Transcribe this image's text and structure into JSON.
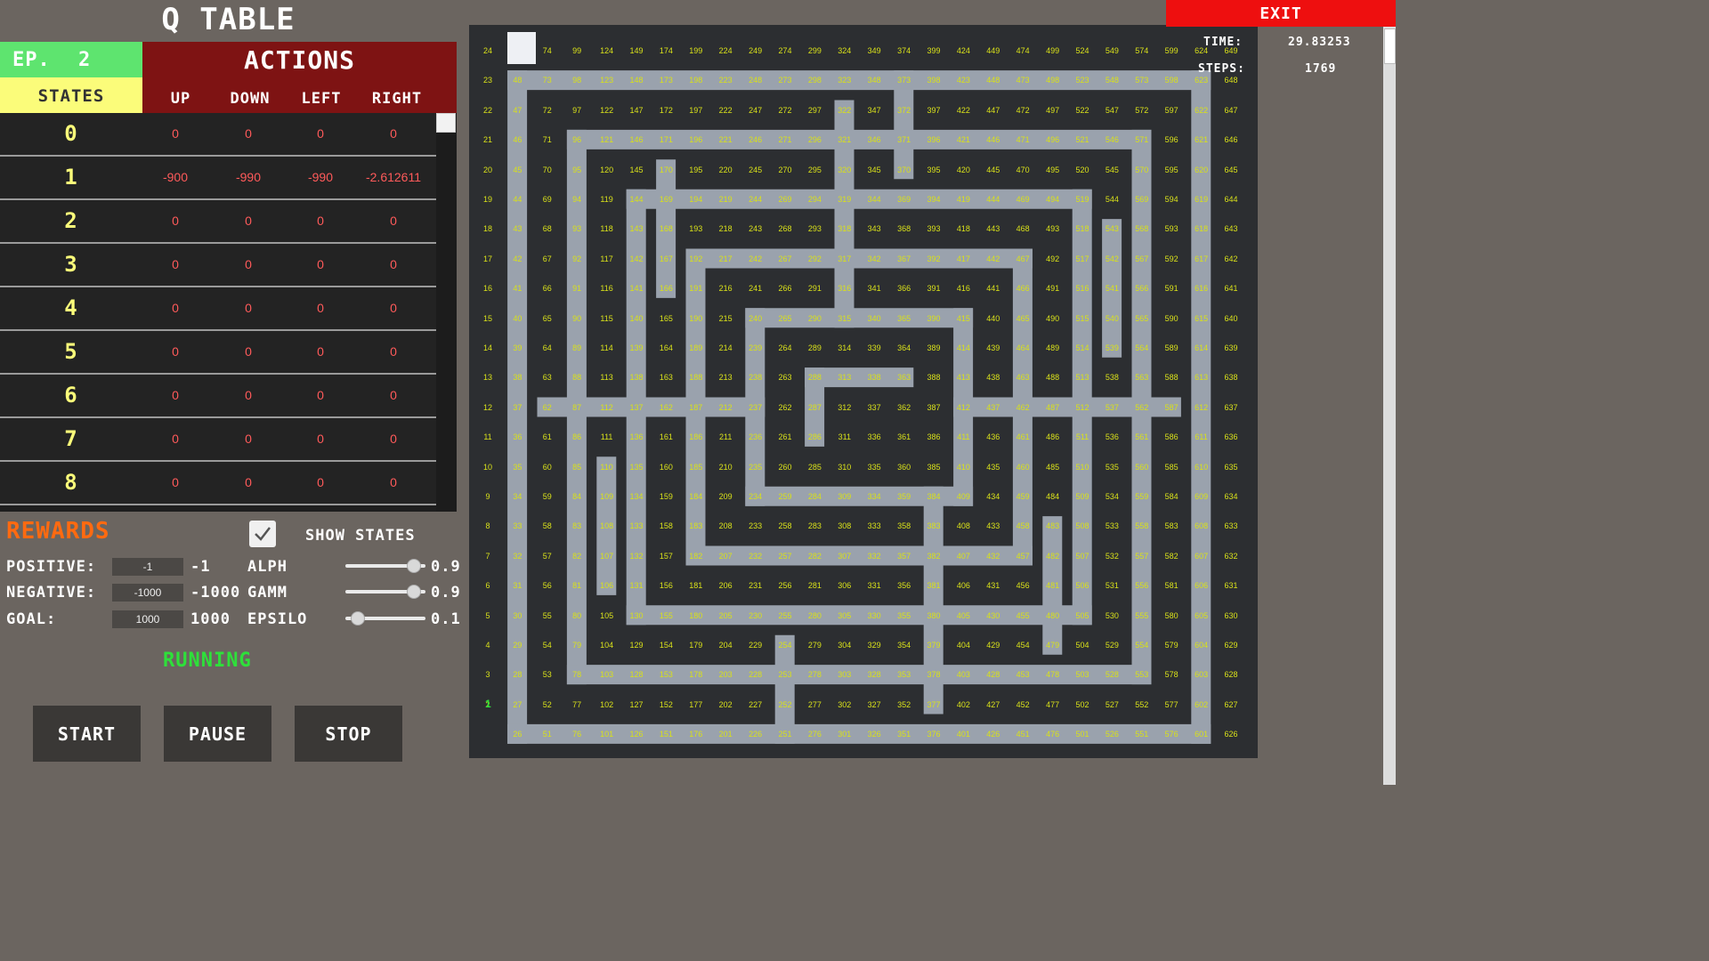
{
  "qtable": {
    "title": "Q TABLE",
    "episode_label": "EP.",
    "episode_value": "2",
    "states_header": "STATES",
    "actions_header": "ACTIONS",
    "columns": [
      "UP",
      "DOWN",
      "LEFT",
      "RIGHT"
    ],
    "rows": [
      {
        "state": "0",
        "values": [
          "0",
          "0",
          "0",
          "0"
        ]
      },
      {
        "state": "1",
        "values": [
          "-900",
          "-990",
          "-990",
          "-2.612611"
        ]
      },
      {
        "state": "2",
        "values": [
          "0",
          "0",
          "0",
          "0"
        ]
      },
      {
        "state": "3",
        "values": [
          "0",
          "0",
          "0",
          "0"
        ]
      },
      {
        "state": "4",
        "values": [
          "0",
          "0",
          "0",
          "0"
        ]
      },
      {
        "state": "5",
        "values": [
          "0",
          "0",
          "0",
          "0"
        ]
      },
      {
        "state": "6",
        "values": [
          "0",
          "0",
          "0",
          "0"
        ]
      },
      {
        "state": "7",
        "values": [
          "0",
          "0",
          "0",
          "0"
        ]
      },
      {
        "state": "8",
        "values": [
          "0",
          "0",
          "0",
          "0"
        ]
      }
    ]
  },
  "rewards": {
    "title": "REWARDS",
    "positive_label": "POSITIVE:",
    "positive_value": "-1",
    "positive_display": "-1",
    "negative_label": "NEGATIVE:",
    "negative_value": "-1000",
    "negative_display": "-1000",
    "goal_label": "GOAL:",
    "goal_value": "1000",
    "goal_display": "1000"
  },
  "params": {
    "show_states_label": "SHOW STATES",
    "show_states_checked": true,
    "alpha_label": "ALPH",
    "alpha_value": "0.9",
    "gamma_label": "GAMM",
    "gamma_value": "0.9",
    "epsilon_label": "EPSILO",
    "epsilon_value": "0.1"
  },
  "status": "RUNNING",
  "buttons": {
    "start": "START",
    "pause": "PAUSE",
    "stop": "STOP"
  },
  "exit_label": "EXIT",
  "hud": {
    "time_label": "TIME:",
    "time_value": "29.83253",
    "steps_label": "STEPS:",
    "steps_value": "1769"
  },
  "maze": {
    "rows": 25,
    "cols": 26,
    "agent_state_label": "1",
    "colors": {
      "wall": "#2c2e31",
      "floor": "#9aa2ad",
      "state_text": "#d8e01a",
      "agent": "#2ee03a"
    }
  }
}
